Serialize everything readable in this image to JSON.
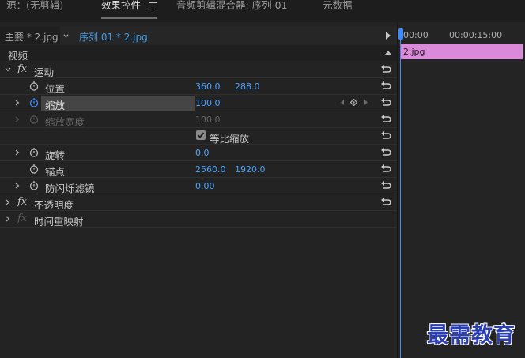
{
  "tabs": [
    {
      "label": "源：(无剪辑)",
      "active": false
    },
    {
      "label": "效果控件",
      "active": true
    },
    {
      "label": "音频剪辑混合器: 序列 01",
      "active": false
    },
    {
      "label": "元数据",
      "active": false
    }
  ],
  "header": {
    "main_clip": "主要 * 2.jpg",
    "sequence_clip": "序列 01 * 2.jpg"
  },
  "section_video": "视频",
  "effects": {
    "motion": {
      "label": "运动"
    },
    "position": {
      "label": "位置",
      "x": "360.0",
      "y": "288.0"
    },
    "scale": {
      "label": "缩放",
      "value": "100.0"
    },
    "scale_width": {
      "label": "缩放宽度",
      "value": "100.0"
    },
    "uniform_scale": {
      "label": "等比缩放",
      "checked": true
    },
    "rotation": {
      "label": "旋转",
      "value": "0.0"
    },
    "anchor": {
      "label": "锚点",
      "x": "2560.0",
      "y": "1920.0"
    },
    "anti_flicker": {
      "label": "防闪烁滤镜",
      "value": "0.00"
    },
    "opacity": {
      "label": "不透明度"
    },
    "time_remap": {
      "label": "时间重映射"
    }
  },
  "timeline": {
    "timecode_start": "00:00",
    "timecode_end": "00:00:15:00",
    "clip_label": "2.jpg",
    "clip_color": "#da8ad9"
  },
  "watermark": "最需教育",
  "colors": {
    "accent_blue": "#4aa3ff",
    "playhead": "#3d8bff"
  }
}
